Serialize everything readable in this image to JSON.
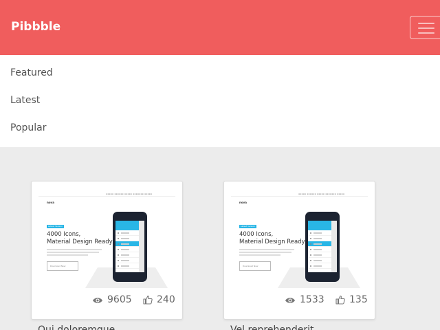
{
  "header": {
    "brand": "Pibbble",
    "menu_toggle_label": "Toggle navigation"
  },
  "nav": {
    "items": [
      {
        "label": "Featured"
      },
      {
        "label": "Latest"
      },
      {
        "label": "Popular"
      }
    ]
  },
  "colors": {
    "brand_red": "#f05d5d",
    "page_bg": "#ececec",
    "accent_blue": "#29b6e6"
  },
  "shots": [
    {
      "title": "Qui doloremque",
      "views": "9605",
      "likes": "240",
      "preview": {
        "logo": "nova",
        "badge": "Latest Version",
        "heading_line1": "4000 Icons,",
        "heading_line2": "Material Design Ready",
        "button": "Download Now"
      }
    },
    {
      "title": "Vel reprehenderit",
      "views": "1533",
      "likes": "135",
      "preview": {
        "logo": "nova",
        "badge": "Latest Version",
        "heading_line1": "4000 Icons,",
        "heading_line2": "Material Design Ready",
        "button": "Download Now"
      }
    }
  ],
  "icons": {
    "views": "eye-icon",
    "likes": "thumbs-up-icon",
    "menu": "hamburger-icon"
  }
}
